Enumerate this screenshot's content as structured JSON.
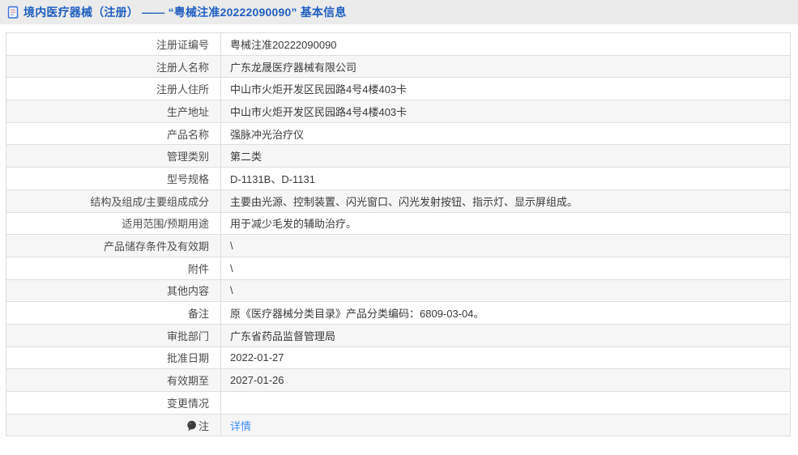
{
  "header": {
    "title": "境内医疗器械（注册） —— “粤械注准20222090090” 基本信息",
    "icon": "document-icon"
  },
  "colors": {
    "title_blue": "#1f5fc1",
    "link_blue": "#3e8ef7",
    "header_bar_bg": "#ebebeb",
    "stripe_bg": "#f6f6f7",
    "table_border": "#dededf"
  },
  "table": {
    "rows": [
      {
        "label": "注册证编号",
        "value": "粤械注准20222090090"
      },
      {
        "label": "注册人名称",
        "value": "广东龙晟医疗器械有限公司"
      },
      {
        "label": "注册人住所",
        "value": "中山市火炬开发区民园路4号4楼403卡"
      },
      {
        "label": "生产地址",
        "value": "中山市火炬开发区民园路4号4楼403卡"
      },
      {
        "label": "产品名称",
        "value": "强脉冲光治疗仪"
      },
      {
        "label": "管理类别",
        "value": "第二类"
      },
      {
        "label": "型号规格",
        "value": "D-1131B、D-1131"
      },
      {
        "label": "结构及组成/主要组成成分",
        "value": "主要由光源、控制装置、闪光窗口、闪光发射按钮、指示灯、显示屏组成。"
      },
      {
        "label": "适用范围/预期用途",
        "value": "用于减少毛发的辅助治疗。"
      },
      {
        "label": "产品储存条件及有效期",
        "value": "\\"
      },
      {
        "label": "附件",
        "value": "\\"
      },
      {
        "label": "其他内容",
        "value": "\\"
      },
      {
        "label": "备注",
        "value": "原《医疗器械分类目录》产品分类编码：6809-03-04。"
      },
      {
        "label": "审批部门",
        "value": "广东省药品监督管理局"
      },
      {
        "label": "批准日期",
        "value": "2022-01-27"
      },
      {
        "label": "有效期至",
        "value": "2027-01-26"
      },
      {
        "label": "变更情况",
        "value": ""
      },
      {
        "label": "注",
        "value": "详情",
        "value_is_link": true,
        "label_icon": "note-balloon-icon"
      }
    ]
  }
}
